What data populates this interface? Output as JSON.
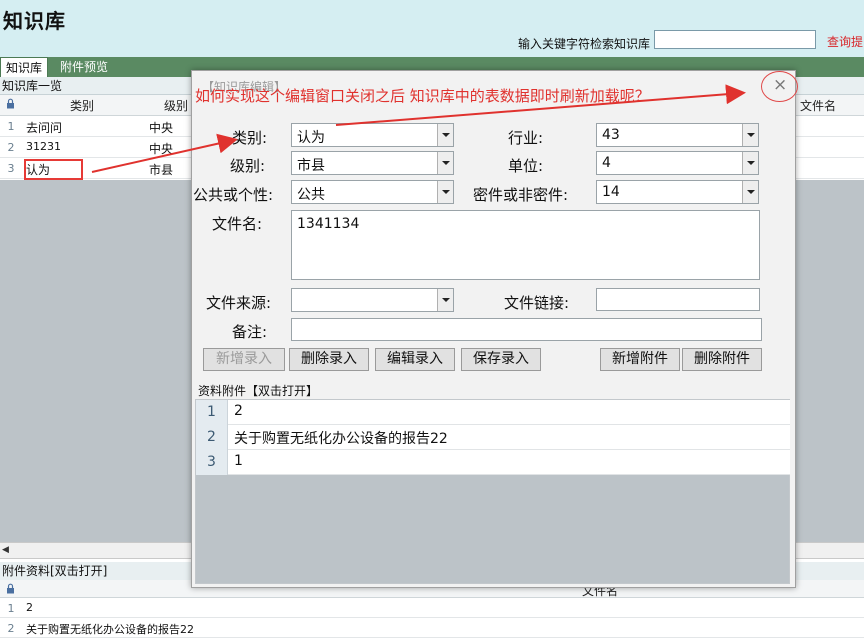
{
  "header": {
    "title": "知识库",
    "search_label": "输入关键字符检索知识库",
    "search_value": "",
    "query_link": "查询提"
  },
  "tabs": [
    {
      "label": "知识库",
      "active": true
    },
    {
      "label": "附件预览",
      "active": false
    }
  ],
  "kb_panel": {
    "title": "知识库一览",
    "columns": [
      "类别",
      "级别",
      "文件名"
    ],
    "rows": [
      {
        "num": "1",
        "category": "去问问",
        "level": "中央"
      },
      {
        "num": "2",
        "category": "31231",
        "level": "中央"
      },
      {
        "num": "3",
        "category": "认为",
        "level": "市县"
      }
    ]
  },
  "attach_panel": {
    "title": "附件资料[双击打开]",
    "column": "文件名",
    "rows": [
      {
        "num": "1",
        "name": "2"
      },
      {
        "num": "2",
        "name": "关于购置无纸化办公设备的报告22"
      }
    ]
  },
  "modal": {
    "title": "【知识库编辑】",
    "labels": {
      "category": "类别:",
      "industry": "行业:",
      "level": "级别:",
      "unit": "单位:",
      "public": "公共或个性:",
      "secret": "密件或非密件:",
      "filename": "文件名:",
      "source": "文件来源:",
      "link": "文件链接:",
      "remark": "备注:"
    },
    "values": {
      "category": "认为",
      "industry": "43",
      "level": "市县",
      "unit": "4",
      "public": "公共",
      "secret": "14",
      "filename": "1341134",
      "source": "",
      "link": "",
      "remark": ""
    },
    "buttons": {
      "add_record": "新增录入",
      "delete_record": "删除录入",
      "edit_record": "编辑录入",
      "save_record": "保存录入",
      "add_attachment": "新增附件",
      "delete_attachment": "删除附件"
    },
    "attachments_title": "资料附件【双击打开】",
    "attachments": [
      {
        "num": "1",
        "name": "2"
      },
      {
        "num": "2",
        "name": "关于购置无纸化办公设备的报告22"
      },
      {
        "num": "3",
        "name": "1"
      }
    ],
    "close_glyph": "×"
  },
  "annotation": {
    "text": "如何实现这个编辑窗口关闭之后 知识库中的表数据即时刷新加载呢？",
    "color": "#e0322e"
  },
  "colors": {
    "header_bg": "#d5eef2",
    "tabbar_bg": "#5a8a62",
    "grid_gray": "#bcc3c8",
    "annotation_red": "#e0322e"
  }
}
